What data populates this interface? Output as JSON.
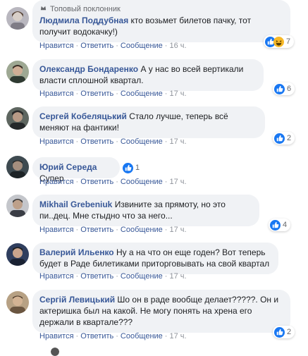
{
  "top_fan_label": "Топовый поклонник",
  "actions": {
    "like": "Нравится",
    "reply": "Ответить",
    "message": "Сообщение"
  },
  "comments": [
    {
      "author": "Людмила Поддубная",
      "text": "кто возьмет билетов пачку, тот получит водокачку!)",
      "time": "16 ч.",
      "reaction_count": "7",
      "reactions": [
        "like-icon",
        "haha-icon"
      ],
      "avatar_color": "#b9b7bf"
    },
    {
      "author": "Олександр Бондаренко",
      "text": "А у нас во всей вертикали власти сплошной квартал.",
      "time": "17 ч.",
      "reaction_count": "6",
      "reactions": [
        "like-icon"
      ],
      "avatar_color": "#8f9a84"
    },
    {
      "author": "Сергей Кобеляцький",
      "text": "Стало лучше, теперь всё меняют на фантики!",
      "time": "17 ч.",
      "reaction_count": "2",
      "reactions": [
        "like-icon"
      ],
      "avatar_color": "#4b4f4a"
    },
    {
      "author": "Юрий Середа",
      "text": "Супер",
      "time": "17 ч.",
      "reaction_count": "1",
      "reactions": [
        "like-icon"
      ],
      "avatar_color": "#4d5860"
    },
    {
      "author": "Mikhail Grebeniuk",
      "text": "Извините за прямоту, но это пи..дец. Мне стыдно что за него...",
      "time": "17 ч.",
      "reaction_count": "4",
      "reactions": [
        "like-icon"
      ],
      "avatar_color": "#8d8e93"
    },
    {
      "author": "Валерий Ильенко",
      "text": "Ну а на что он еще годен? Вот теперь будет в Раде билетиками приторговывать на свой квартал",
      "time": "17 ч.",
      "reaction_count": "",
      "reactions": [],
      "avatar_color": "#3b4a6a"
    },
    {
      "author": "Сергій Левицький",
      "text": "Шо он в раде вообще делает?????. Он и актеришка был на какой. Не могу понять на хрена его держали в квартале???",
      "time": "17 ч.",
      "reaction_count": "2",
      "reactions": [
        "like-icon"
      ],
      "avatar_color": "#a08a70"
    }
  ],
  "colors": {
    "author": "#385898",
    "bubble_bg": "#f0f2f5",
    "like_blue": "#1877f2",
    "haha_yellow": "#f7b928"
  }
}
